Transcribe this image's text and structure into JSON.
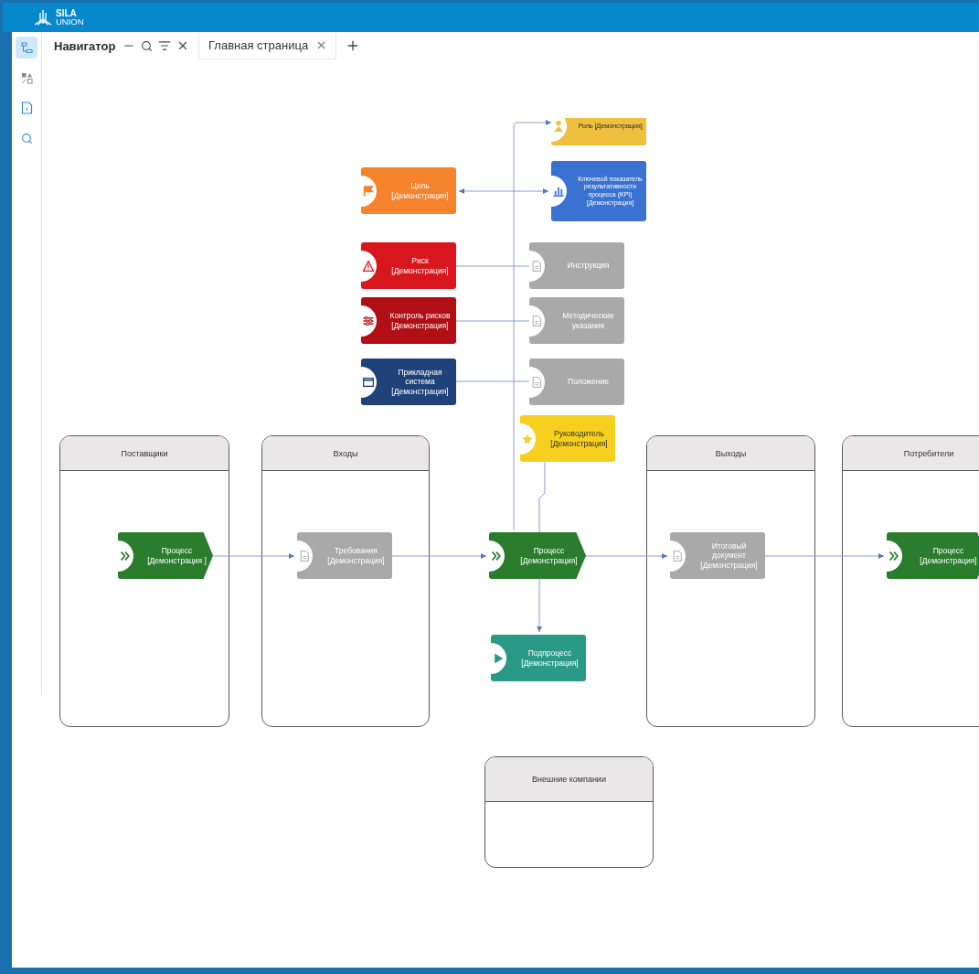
{
  "header": {
    "logo_top": "SILA",
    "logo_bottom": "UNION"
  },
  "rail": [
    {
      "kind": "tree",
      "selected": true
    },
    {
      "kind": "shapes",
      "selected": false
    },
    {
      "kind": "document",
      "selected": false
    },
    {
      "kind": "search",
      "selected": false
    }
  ],
  "navigator": {
    "title": "Навигатор"
  },
  "tabs": [
    {
      "label": "Главная страница",
      "selected": true
    }
  ],
  "lanes": [
    {
      "title": "Поставщики"
    },
    {
      "title": "Входы"
    },
    {
      "title": "Выходы"
    },
    {
      "title": "Потребители"
    },
    {
      "title": "Внешние компании"
    }
  ],
  "nodes": [
    {
      "kind": "role",
      "color": "#efc03e",
      "text": "Роль [Демонстрация]"
    },
    {
      "kind": "goal",
      "color": "#f5832b",
      "text": "Цель [Демонстрация]"
    },
    {
      "kind": "kpi",
      "color": "#3a72d2",
      "text": "Ключевой показатель результативности процесса (KPI) [Демонстрация]"
    },
    {
      "kind": "risk",
      "color": "#d8161d",
      "text": "Риск [Демонстрация]"
    },
    {
      "kind": "document",
      "color": "#a9a9a9",
      "text": "Инструкция"
    },
    {
      "kind": "control",
      "color": "#b10f15",
      "text": "Контроль рисков [Демонстрация]"
    },
    {
      "kind": "document",
      "color": "#a9a9a9",
      "text": "Методические указания"
    },
    {
      "kind": "system",
      "color": "#20427a",
      "text": "Прикладная система [Демонстрация]"
    },
    {
      "kind": "document",
      "color": "#a9a9a9",
      "text": "Положение"
    },
    {
      "kind": "manager",
      "color": "#f6cf1f",
      "text": "Руководитель [Демонстрация]"
    },
    {
      "kind": "process",
      "color": "#2b7d2e",
      "text": "Процесс [Демонстрация ]"
    },
    {
      "kind": "document",
      "color": "#a9a9a9",
      "text": "Требования [Демонстрация]"
    },
    {
      "kind": "process",
      "color": "#2b7d2e",
      "text": "Процесс [Демонстрация]"
    },
    {
      "kind": "document",
      "color": "#a9a9a9",
      "text": "Итоговый документ [Демонстрация]"
    },
    {
      "kind": "process",
      "color": "#2b7d2e",
      "text": "Процесс [Демонстрация]"
    },
    {
      "kind": "subprocess",
      "color": "#2a9a86",
      "text": "Подпроцесс [Демонстрация]"
    }
  ]
}
